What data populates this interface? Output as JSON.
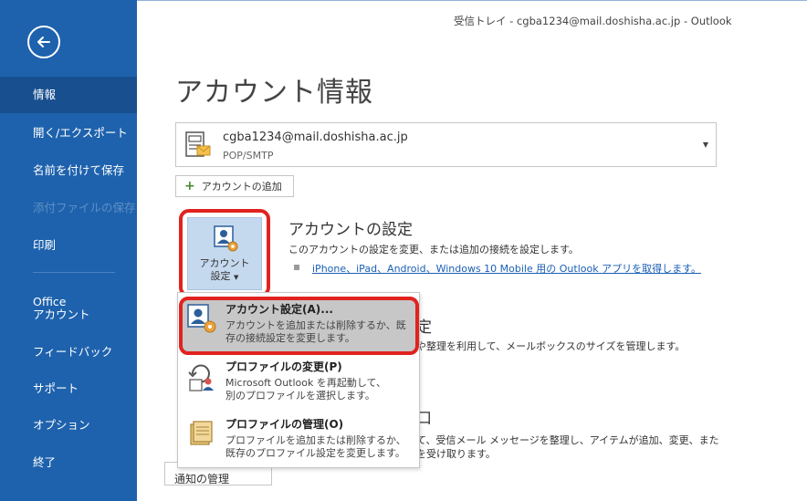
{
  "window_title": "受信トレイ - cgba1234@mail.doshisha.ac.jp  -  Outlook",
  "sidebar": {
    "back_icon": "back-arrow-icon",
    "items": [
      {
        "label": "情報",
        "state": "active"
      },
      {
        "label": "開く/エクスポート",
        "state": "normal"
      },
      {
        "label": "名前を付けて保存",
        "state": "normal"
      },
      {
        "label": "添付ファイルの保存",
        "state": "disabled"
      },
      {
        "label": "印刷",
        "state": "normal"
      },
      {
        "label": "Office\nアカウント",
        "state": "normal"
      },
      {
        "label": "フィードバック",
        "state": "normal"
      },
      {
        "label": "サポート",
        "state": "normal"
      },
      {
        "label": "オプション",
        "state": "normal"
      },
      {
        "label": "終了",
        "state": "normal"
      }
    ]
  },
  "page_title": "アカウント情報",
  "account": {
    "email": "cgba1234@mail.doshisha.ac.jp",
    "type": "POP/SMTP",
    "icon": "mail-account-icon"
  },
  "add_account_label": "アカウントの追加",
  "account_settings": {
    "button_line1": "アカウント",
    "button_line2": "設定",
    "heading": "アカウントの設定",
    "description": "このアカウントの設定を変更、または追加の接続を設定します。",
    "link": "iPhone、iPad、Android、Windows 10 Mobile 用の Outlook アプリを取得します。"
  },
  "background": {
    "heading2": "定",
    "desc2": "や整理を利用して、メールボックスのサイズを管理します。",
    "heading3": "口",
    "desc3a": "て、受信メール メッセージを整理し、アイテムが追加、変更、また",
    "desc3b": "を受け取ります。",
    "button3": "通知の管理"
  },
  "menu": [
    {
      "title": "アカウント設定(A)...",
      "desc1": "アカウントを追加または削除するか、既",
      "desc2": "存の接続設定を変更します。",
      "icon": "account-settings-icon"
    },
    {
      "title": "プロファイルの変更(P)",
      "desc1": "Microsoft Outlook を再起動して、",
      "desc2": "別のプロファイルを選択します。",
      "icon": "change-profile-icon"
    },
    {
      "title": "プロファイルの管理(O)",
      "desc1": "プロファイルを追加または削除するか、",
      "desc2": "既存のプロファイル設定を変更します。",
      "icon": "manage-profiles-icon"
    }
  ],
  "colors": {
    "sidebar": "#1e62ad",
    "highlight": "#e0231f",
    "link": "#1a5fb4"
  }
}
